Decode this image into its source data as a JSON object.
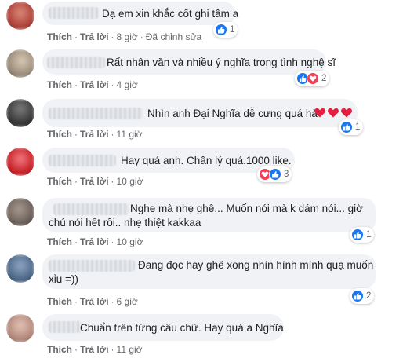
{
  "comments": [
    {
      "text": [
        "Dạ em xin khắc cốt ghi tâm a"
      ],
      "actions": [
        "Thích",
        "Trả lời",
        "8 giờ",
        "Đã chỉnh sửa"
      ],
      "reactions": {
        "types": [
          "like"
        ],
        "count": "1"
      },
      "avatar_color": "#b0433c"
    },
    {
      "text": [
        "Rất nhân văn và nhiều ý nghĩa trong tình nghệ sĩ"
      ],
      "actions": [
        "Thích",
        "Trả lời",
        "4 giờ"
      ],
      "reactions": {
        "types": [
          "like",
          "love"
        ],
        "count": "2"
      },
      "avatar_color": "#9c8d7c"
    },
    {
      "text": [
        "Nhìn anh Đại Nghĩa dễ cưng quá hà"
      ],
      "emoji": "❤❤❤",
      "actions": [
        "Thích",
        "Trả lời",
        "11 giờ"
      ],
      "reactions": {
        "types": [
          "like"
        ],
        "count": "1"
      },
      "avatar_color": "#3a3a3a"
    },
    {
      "text": [
        "Hay quá anh. Chân lý quá.1000 like."
      ],
      "actions": [
        "Thích",
        "Trả lời",
        "10 giờ"
      ],
      "reactions": {
        "types": [
          "love",
          "like"
        ],
        "count": "3"
      },
      "avatar_color": "#c8242b"
    },
    {
      "text": [
        "Nghe mà nhẹ ghê... Muốn nói mà k dám nói... giờ",
        "chú nói hết rồi.. nhẹ thiệt kakkaa"
      ],
      "actions": [
        "Thích",
        "Trả lời",
        "10 giờ"
      ],
      "reactions": {
        "types": [
          "like"
        ],
        "count": "1"
      },
      "avatar_color": "#6d625b"
    },
    {
      "text": [
        "Đang đọc hay ghê xong nhìn hình mình quạ muốn",
        "xỉu =))"
      ],
      "actions": [
        "Thích",
        "Trả lời",
        "6 giờ"
      ],
      "reactions": {
        "types": [
          "like"
        ],
        "count": "2"
      },
      "avatar_color": "#4f6a8a"
    },
    {
      "text": [
        "Chuẩn trên từng câu chữ. Hay quá a Nghĩa"
      ],
      "actions": [
        "Thích",
        "Trả lời",
        "11 giờ"
      ],
      "reactions": {
        "types": [],
        "count": ""
      },
      "avatar_color": "#b58b7d"
    }
  ],
  "colors": {
    "like": "#1877f2",
    "love": "#f33e58",
    "heart": "#e41e3f",
    "bubble": "#f0f2f5",
    "meta": "#65676b"
  }
}
